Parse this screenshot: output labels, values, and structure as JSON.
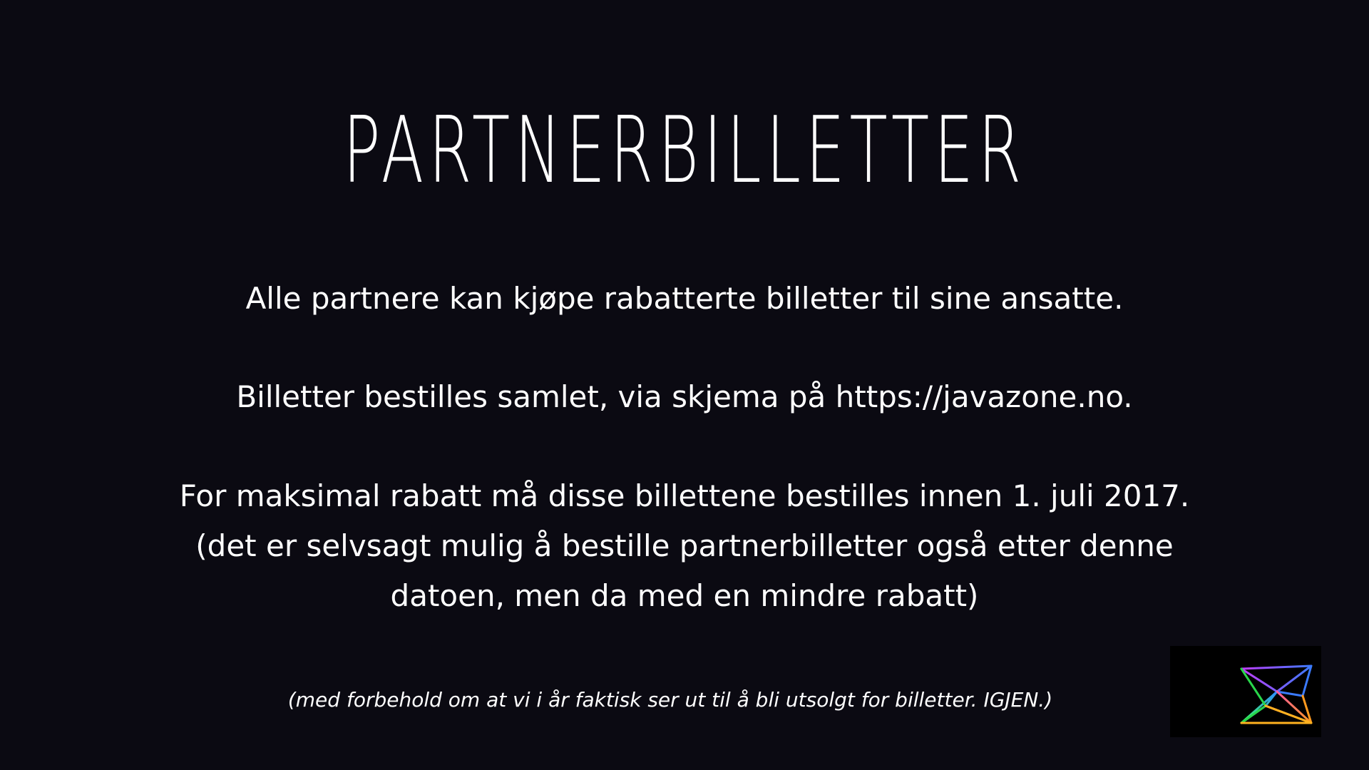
{
  "slide": {
    "title": "PARTNERBILLETTER",
    "lines": [
      "Alle partnere kan kjøpe rabatterte billetter til sine ansatte.",
      "Billetter bestilles samlet, via skjema på https://javazone.no.",
      "For maksimal rabatt må disse billettene bestilles innen 1. juli 2017.",
      "(det er selvsagt mulig å bestille partnerbilletter også etter denne",
      "datoen, men da med en mindre rabatt)"
    ],
    "footnote": "(med forbehold om at vi i år faktisk ser ut til å bli utsolgt for billetter. IGJEN.)"
  },
  "colors": {
    "background": "#0b0a12",
    "text": "#ffffff",
    "logo_background": "#000000"
  },
  "logo": {
    "icon": "javazone-logo-icon"
  }
}
